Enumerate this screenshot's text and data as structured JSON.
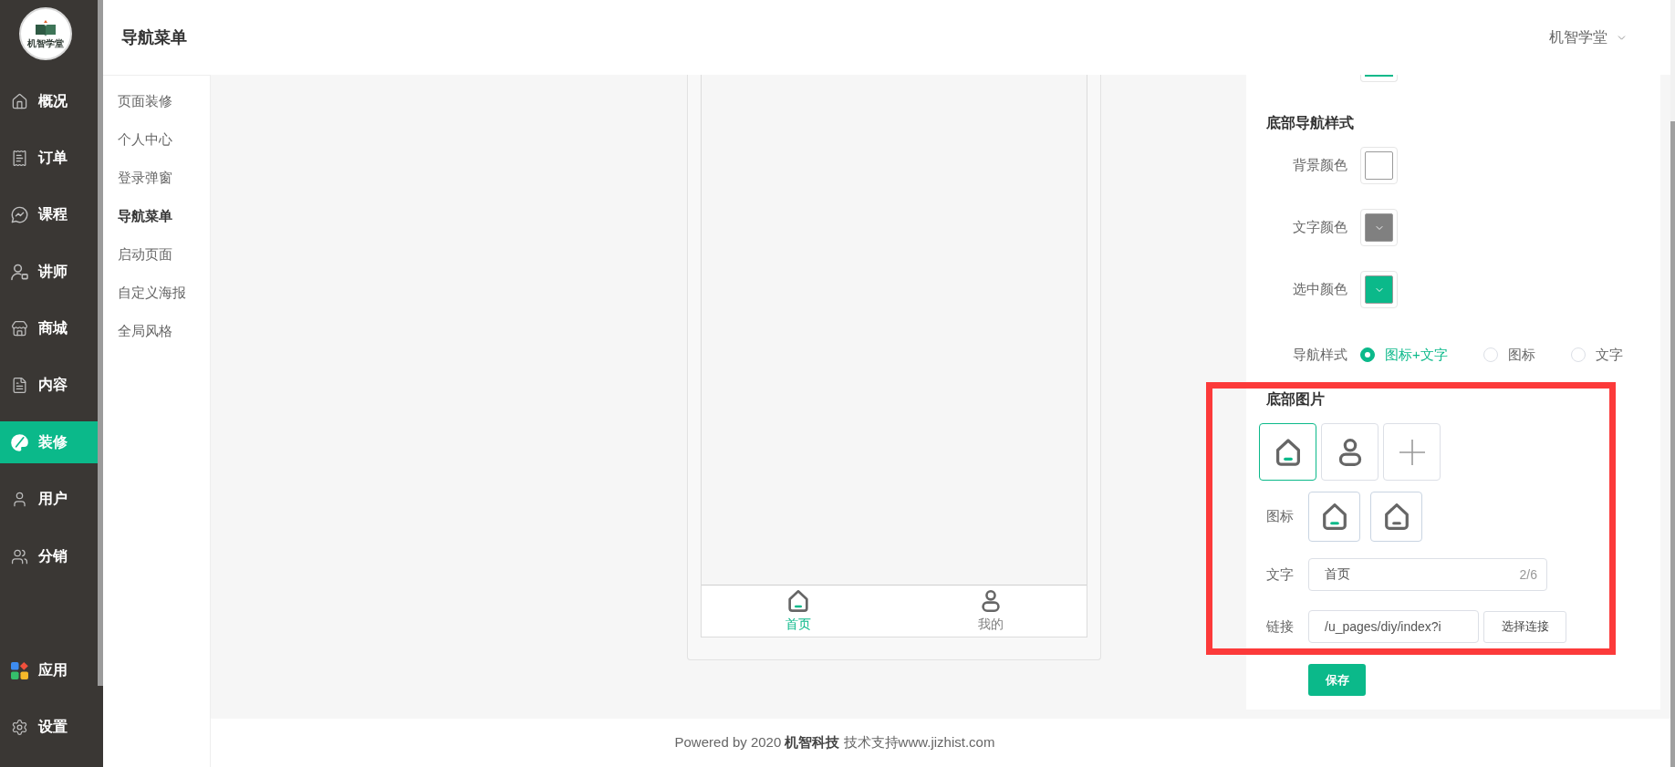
{
  "sidebar": {
    "logo": {
      "text": "机智学堂"
    },
    "items": [
      {
        "label": "概况",
        "selected": false
      },
      {
        "label": "订单",
        "selected": false
      },
      {
        "label": "课程",
        "selected": false
      },
      {
        "label": "讲师",
        "selected": false
      },
      {
        "label": "商城",
        "selected": false
      },
      {
        "label": "内容",
        "selected": false
      },
      {
        "label": "装修",
        "selected": true
      },
      {
        "label": "用户",
        "selected": false
      },
      {
        "label": "分销",
        "selected": false
      }
    ],
    "bottom_items": [
      {
        "label": "应用",
        "selected": false
      },
      {
        "label": "设置",
        "selected": false
      }
    ]
  },
  "header": {
    "title": "导航菜单",
    "account": "机智学堂"
  },
  "subnav": {
    "items": [
      {
        "label": "页面装修",
        "selected": false
      },
      {
        "label": "个人中心",
        "selected": false
      },
      {
        "label": "登录弹窗",
        "selected": false
      },
      {
        "label": "导航菜单",
        "selected": true
      },
      {
        "label": "启动页面",
        "selected": false
      },
      {
        "label": "自定义海报",
        "selected": false
      },
      {
        "label": "全局风格",
        "selected": false
      }
    ]
  },
  "preview": {
    "tabs": [
      {
        "label": "首页",
        "selected": true
      },
      {
        "label": "我的",
        "selected": false
      }
    ]
  },
  "settings": {
    "top_picker": {
      "color": "#0bb98a"
    },
    "nav_style": {
      "title": "底部导航样式",
      "colors": [
        {
          "label": "背景颜色",
          "color": "#ffffff"
        },
        {
          "label": "文字颜色",
          "color": "#808080"
        },
        {
          "label": "选中颜色",
          "color": "#0bb98a"
        }
      ],
      "style": {
        "label": "导航样式",
        "options": [
          {
            "label": "图标+文字",
            "selected": true
          },
          {
            "label": "图标",
            "selected": false
          },
          {
            "label": "文字",
            "selected": false
          }
        ]
      }
    },
    "bottom_images": {
      "title": "底部图片",
      "tiles": [
        {
          "kind": "image",
          "selected": true
        },
        {
          "kind": "image",
          "selected": false
        },
        {
          "kind": "add",
          "selected": false
        }
      ],
      "icon_field": {
        "label": "图标",
        "icons": [
          {
            "kind": "active"
          },
          {
            "kind": "normal"
          }
        ]
      },
      "text_field": {
        "label": "文字",
        "value": "首页",
        "count": "2/6"
      },
      "link_field": {
        "label": "链接",
        "value": "/u_pages/diy/index?i",
        "button": "选择连接"
      }
    },
    "save_button": "保存"
  },
  "footer": {
    "text": "Powered by 2020 **机智科技** 技术支持www.jizhist.com"
  }
}
